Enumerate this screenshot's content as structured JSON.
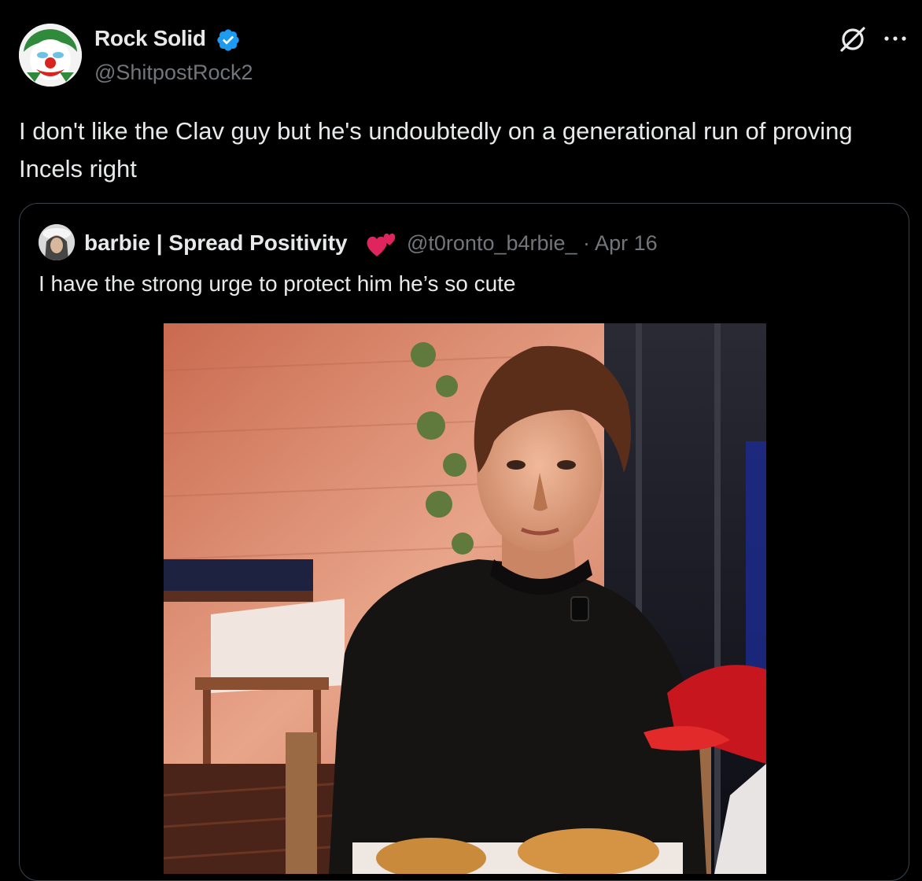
{
  "author": {
    "display_name": "Rock Solid",
    "handle": "@ShitpostRock2",
    "verified": true
  },
  "post": {
    "text": "I don't like the Clav guy but he's undoubtedly on a generational run of proving Incels right"
  },
  "quoted": {
    "display_name": "barbie | Spread Positivity",
    "handle_date": "@t0ronto_b4rbie_ · Apr 16",
    "text": "I have the strong urge to protect him he’s so cute"
  },
  "icons": {
    "verified": "verified-badge-icon",
    "grok": "grok-icon",
    "more": "more-icon",
    "heart": "two-hearts-emoji"
  },
  "colors": {
    "background": "#000000",
    "text": "#e7e9ea",
    "muted": "#71767b",
    "verified": "#1d9bf0",
    "border": "#38444d"
  }
}
